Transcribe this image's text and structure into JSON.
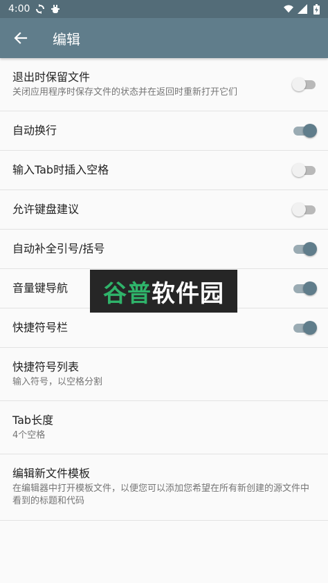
{
  "status_bar": {
    "time": "4:00"
  },
  "app_bar": {
    "title": "编辑"
  },
  "settings": [
    {
      "title": "退出时保留文件",
      "summary": "关闭应用程序时保存文件的状态并在返回时重新打开它们",
      "switch": false
    },
    {
      "title": "自动换行",
      "switch": true
    },
    {
      "title": "输入Tab时插入空格",
      "switch": false
    },
    {
      "title": "允许键盘建议",
      "switch": false
    },
    {
      "title": "自动补全引号/括号",
      "switch": true
    },
    {
      "title": "音量键导航",
      "switch": true
    },
    {
      "title": "快捷符号栏",
      "switch": true
    },
    {
      "title": "快捷符号列表",
      "summary": "输入符号，以空格分割"
    },
    {
      "title": "Tab长度",
      "summary": "4个空格"
    },
    {
      "title": "编辑新文件模板",
      "summary": "在编辑器中打开模板文件，以便您可以添加您希望在所有新创建的源文件中看到的标题和代码"
    }
  ],
  "watermark": {
    "part1": "谷普",
    "part2": "软件园"
  },
  "colors": {
    "primary": "#607d8b",
    "primary_dark": "#536c78"
  },
  "icons": [
    "back-arrow-icon",
    "sync-icon",
    "debug-icon",
    "wifi-icon",
    "signal-icon",
    "battery-icon"
  ]
}
